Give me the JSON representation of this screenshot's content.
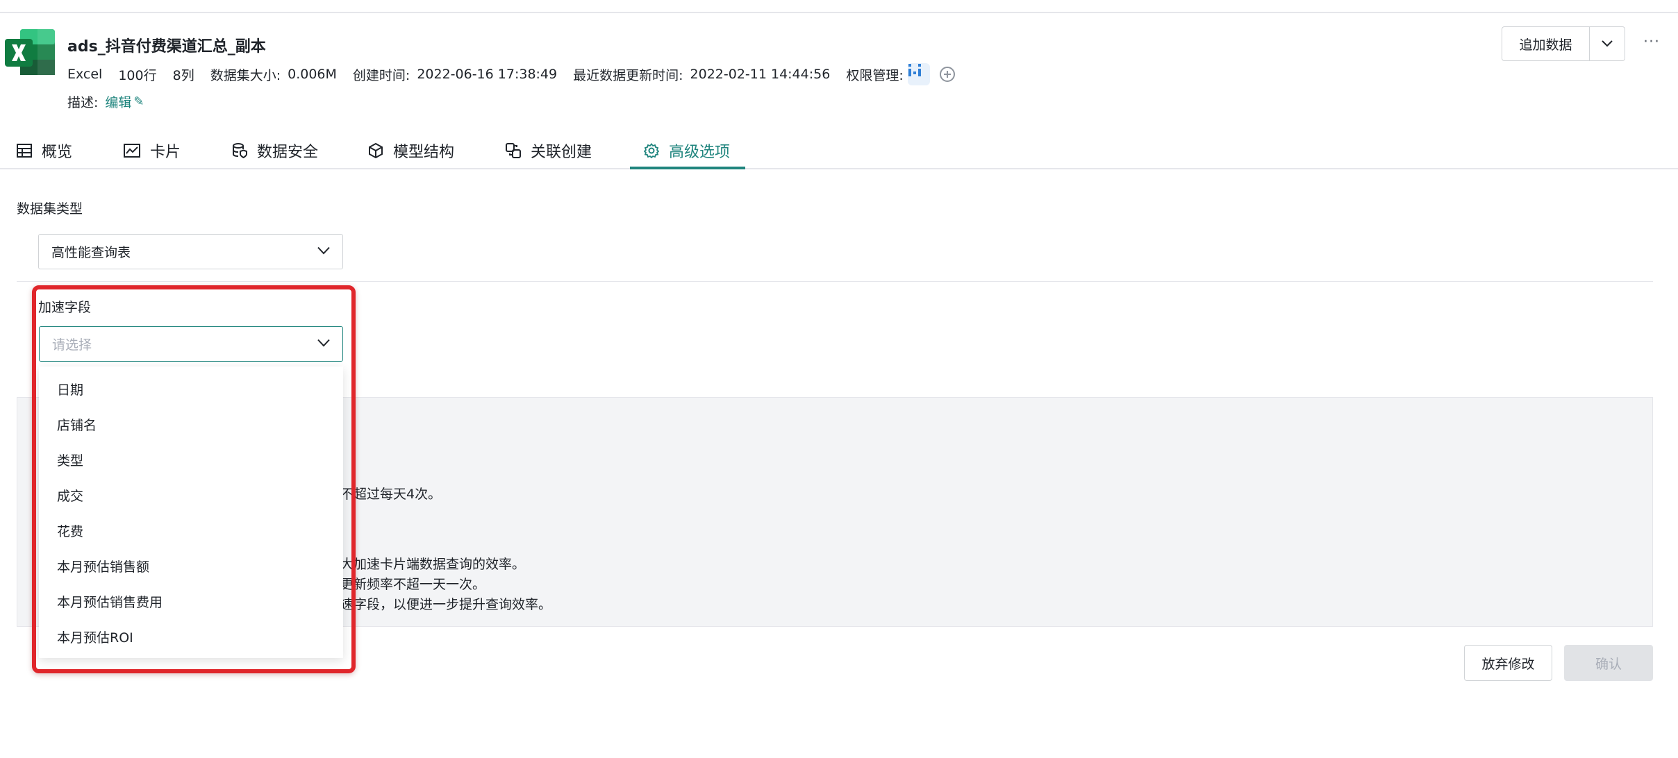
{
  "header": {
    "title": "ads_抖音付费渠道汇总_副本",
    "meta": {
      "type": "Excel",
      "rows": "100行",
      "cols": "8列",
      "size_label": "数据集大小:",
      "size_value": "0.006M",
      "created_label": "创建时间:",
      "created_value": "2022-06-16 17:38:49",
      "updated_label": "最近数据更新时间:",
      "updated_value": "2022-02-11 14:44:56",
      "perm_label": "权限管理:"
    },
    "desc_label": "描述:",
    "edit_link": "编辑",
    "append_button": "追加数据",
    "more": "···"
  },
  "tabs": [
    {
      "label": "概览",
      "icon": "table-icon"
    },
    {
      "label": "卡片",
      "icon": "line-chart-icon"
    },
    {
      "label": "数据安全",
      "icon": "database-shield-icon"
    },
    {
      "label": "模型结构",
      "icon": "cube-icon"
    },
    {
      "label": "关联创建",
      "icon": "link-create-icon"
    },
    {
      "label": "高级选项",
      "icon": "gear-icon",
      "active": true
    }
  ],
  "dataset_type": {
    "label": "数据集类型",
    "selected": "高性能查询表"
  },
  "accel_field": {
    "label": "加速字段",
    "placeholder": "请选择",
    "options": [
      "日期",
      "店铺名",
      "类型",
      "成交",
      "花费",
      "本月预估销售额",
      "本月预估销售费用",
      "本月预估ROI"
    ]
  },
  "info_visible": [
    "不超过每天4次。",
    "大加速卡片端数据查询的效率。",
    "更新频率不超一天一次。",
    "速字段，以便进一步提升查询效率。"
  ],
  "footer": {
    "discard": "放弃修改",
    "confirm": "确认"
  },
  "colors": {
    "accent": "#20857e",
    "highlight_border": "#e0262b",
    "excel_green": "#21a366"
  }
}
